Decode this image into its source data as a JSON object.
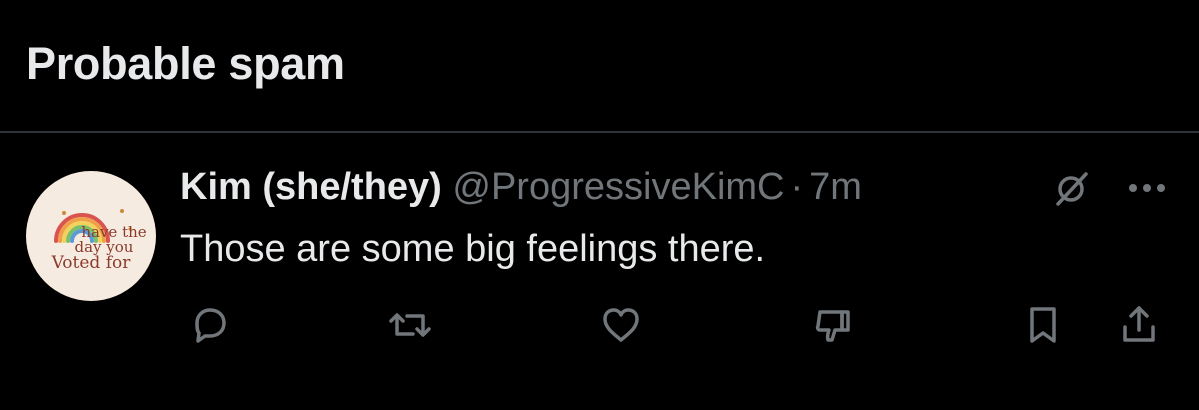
{
  "section": {
    "title": "Probable spam"
  },
  "post": {
    "author_name": "Kim (she/they)",
    "author_handle": "@ProgressiveKimC",
    "separator": "·",
    "time": "7m",
    "text": "Those are some big feelings there.",
    "avatar": {
      "lines": [
        "have the",
        "day you",
        "Voted for"
      ],
      "background": "#f6ebe0",
      "text_color": "#8b3a2b"
    },
    "actions": [
      {
        "name": "reply",
        "icon": "reply-icon"
      },
      {
        "name": "repost",
        "icon": "repost-icon"
      },
      {
        "name": "like",
        "icon": "heart-icon"
      },
      {
        "name": "downvote",
        "icon": "thumbs-down-icon"
      },
      {
        "name": "bookmark",
        "icon": "bookmark-icon"
      },
      {
        "name": "share",
        "icon": "share-icon"
      }
    ]
  },
  "colors": {
    "background": "#000000",
    "primary_text": "#e7e9ea",
    "secondary_text": "#71767b",
    "divider": "#2f3336"
  }
}
